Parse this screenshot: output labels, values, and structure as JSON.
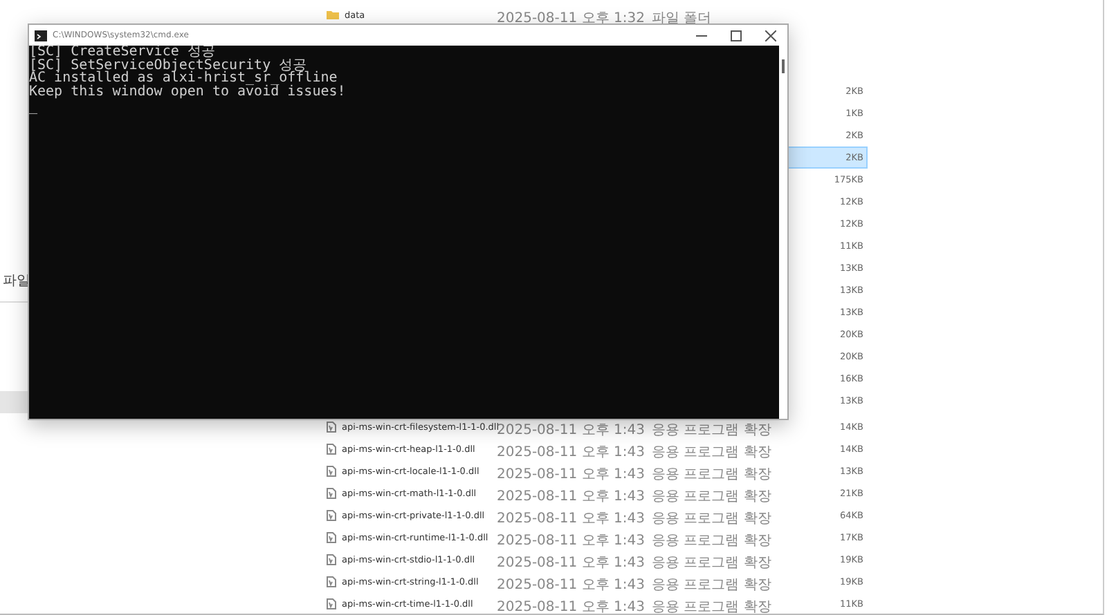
{
  "sidebar": {
    "label": "파일"
  },
  "files": [
    {
      "kind": "folder",
      "name": "data",
      "date": "2025-08-11 오후 1:32",
      "type": "파일 폴더",
      "selected": false
    },
    {
      "kind": "gap"
    },
    {
      "kind": "file",
      "size": "2KB",
      "selected": false
    },
    {
      "kind": "file",
      "size": "1KB",
      "selected": false
    },
    {
      "kind": "file",
      "size": "2KB",
      "selected": false
    },
    {
      "kind": "file",
      "size": "2KB",
      "selected": true
    },
    {
      "kind": "file",
      "size": "175KB",
      "selected": false
    },
    {
      "kind": "file",
      "size": "12KB",
      "selected": false
    },
    {
      "kind": "file",
      "size": "12KB",
      "selected": false
    },
    {
      "kind": "file",
      "size": "11KB",
      "selected": false
    },
    {
      "kind": "file",
      "size": "13KB",
      "selected": false
    },
    {
      "kind": "file",
      "size": "13KB",
      "selected": false
    },
    {
      "kind": "file",
      "size": "13KB",
      "selected": false
    },
    {
      "kind": "file",
      "size": "20KB",
      "selected": false
    },
    {
      "kind": "file",
      "size": "20KB",
      "selected": false
    },
    {
      "kind": "file",
      "size": "16KB",
      "selected": false
    },
    {
      "kind": "file",
      "size": "13KB",
      "selected": false
    },
    {
      "kind": "file",
      "name": "api-ms-win-crt-filesystem-l1-1-0.dll",
      "date": "2025-08-11 오후 1:43",
      "type": "응용 프로그램 확장",
      "size": "14KB",
      "selected": false
    },
    {
      "kind": "file",
      "name": "api-ms-win-crt-heap-l1-1-0.dll",
      "date": "2025-08-11 오후 1:43",
      "type": "응용 프로그램 확장",
      "size": "14KB",
      "selected": false
    },
    {
      "kind": "file",
      "name": "api-ms-win-crt-locale-l1-1-0.dll",
      "date": "2025-08-11 오후 1:43",
      "type": "응용 프로그램 확장",
      "size": "13KB",
      "selected": false
    },
    {
      "kind": "file",
      "name": "api-ms-win-crt-math-l1-1-0.dll",
      "date": "2025-08-11 오후 1:43",
      "type": "응용 프로그램 확장",
      "size": "21KB",
      "selected": false
    },
    {
      "kind": "file",
      "name": "api-ms-win-crt-private-l1-1-0.dll",
      "date": "2025-08-11 오후 1:43",
      "type": "응용 프로그램 확장",
      "size": "64KB",
      "selected": false
    },
    {
      "kind": "file",
      "name": "api-ms-win-crt-runtime-l1-1-0.dll",
      "date": "2025-08-11 오후 1:43",
      "type": "응용 프로그램 확장",
      "size": "17KB",
      "selected": false
    },
    {
      "kind": "file",
      "name": "api-ms-win-crt-stdio-l1-1-0.dll",
      "date": "2025-08-11 오후 1:43",
      "type": "응용 프로그램 확장",
      "size": "19KB",
      "selected": false
    },
    {
      "kind": "file",
      "name": "api-ms-win-crt-string-l1-1-0.dll",
      "date": "2025-08-11 오후 1:43",
      "type": "응용 프로그램 확장",
      "size": "19KB",
      "selected": false
    },
    {
      "kind": "file",
      "name": "api-ms-win-crt-time-l1-1-0.dll",
      "date": "2025-08-11 오후 1:43",
      "type": "응용 프로그램 확장",
      "size": "11KB",
      "selected": false
    }
  ],
  "console": {
    "title": "C:\\WINDOWS\\system32\\cmd.exe",
    "lines": [
      "[SC] CreateService 성공",
      "[SC] SetServiceObjectSecurity 성공",
      "AC installed as alxi-hrist_sr_offline",
      "Keep this window open to avoid issues!"
    ],
    "cursor": "_"
  }
}
